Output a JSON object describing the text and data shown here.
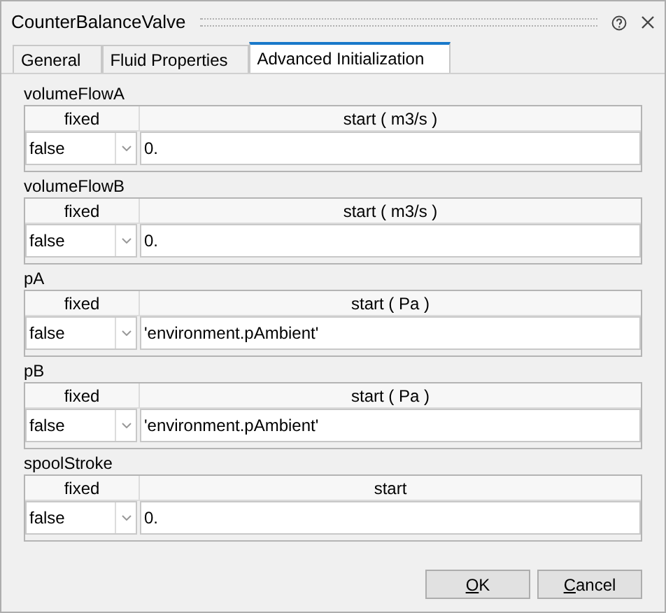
{
  "window": {
    "title": "CounterBalanceValve"
  },
  "tabs": [
    {
      "label": "General",
      "selected": false
    },
    {
      "label": "Fluid Properties",
      "selected": false
    },
    {
      "label": "Advanced Initialization",
      "selected": true
    }
  ],
  "groups": [
    {
      "name": "volumeFlowA",
      "columns": [
        "fixed",
        "start ( m3/s )"
      ],
      "fixed": "false",
      "start": "0."
    },
    {
      "name": "volumeFlowB",
      "columns": [
        "fixed",
        "start ( m3/s )"
      ],
      "fixed": "false",
      "start": "0."
    },
    {
      "name": "pA",
      "columns": [
        "fixed",
        "start ( Pa )"
      ],
      "fixed": "false",
      "start": "'environment.pAmbient'"
    },
    {
      "name": "pB",
      "columns": [
        "fixed",
        "start ( Pa )"
      ],
      "fixed": "false",
      "start": "'environment.pAmbient'"
    },
    {
      "name": "spoolStroke",
      "columns": [
        "fixed",
        "start"
      ],
      "fixed": "false",
      "start": "0."
    }
  ],
  "buttons": [
    {
      "label": "OK",
      "mnemonic_underlined": true
    },
    {
      "label": "Cancel",
      "mnemonic_underlined": true
    }
  ]
}
